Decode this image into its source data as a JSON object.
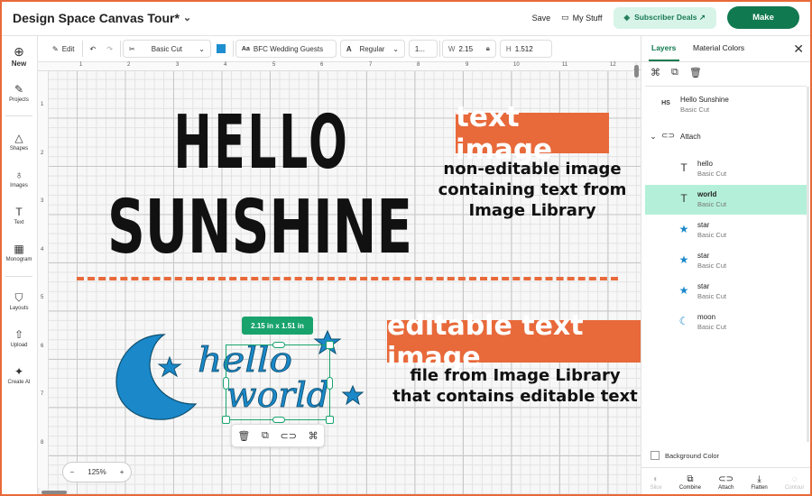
{
  "header": {
    "doc_title": "Design Space Canvas Tour*",
    "save": "Save",
    "my_stuff": "My Stuff",
    "subscriber_deals": "Subscriber Deals ↗",
    "make": "Make"
  },
  "left_rail": {
    "items": [
      {
        "label": "New",
        "icon": "plus-circle-icon"
      },
      {
        "label": "Projects",
        "icon": "projects-icon"
      },
      {
        "label": "Shapes",
        "icon": "shapes-icon"
      },
      {
        "label": "Images",
        "icon": "bulb-icon"
      },
      {
        "label": "Text",
        "icon": "text-icon"
      },
      {
        "label": "Monogram",
        "icon": "monogram-icon"
      },
      {
        "label": "Layouts",
        "icon": "shirt-icon"
      },
      {
        "label": "Upload",
        "icon": "upload-icon"
      },
      {
        "label": "Create AI",
        "icon": "sparkle-icon"
      }
    ]
  },
  "toolbar": {
    "edit": "Edit",
    "operation": "Basic Cut",
    "color": "#1e8ed1",
    "font": "BFC Wedding Guests",
    "style": "Regular",
    "size": "1...",
    "w_label": "W",
    "w_value": "2.15",
    "h_label": "H",
    "h_value": "1.512"
  },
  "rulers": {
    "top": [
      "1",
      "2",
      "3",
      "4",
      "5",
      "6",
      "7",
      "8",
      "9",
      "10",
      "11",
      "12"
    ],
    "left": [
      "1",
      "2",
      "3",
      "4",
      "5",
      "6",
      "7",
      "8"
    ]
  },
  "canvas": {
    "image_line1": "HELLO",
    "image_line2": "SUNSHINE",
    "editable_line1": "hello",
    "editable_line2": "world",
    "dimension_badge": "2.15 in x 1.51 in",
    "zoom": "125%",
    "zoom_minus": "−",
    "zoom_plus": "+"
  },
  "annotations": {
    "top_title": "text image",
    "top_desc_1": "non-editable image",
    "top_desc_2": "containing text from",
    "top_desc_3": "Image Library",
    "bottom_title": "editable text image",
    "bottom_desc_1": "file from Image Library",
    "bottom_desc_2": "that contains editable text",
    "accent": "#e8693a"
  },
  "panel": {
    "tab_layers": "Layers",
    "tab_material": "Material Colors",
    "layers": [
      {
        "name": "Hello Sunshine",
        "sub": "Basic Cut",
        "icon": "image-thumb-icon"
      },
      {
        "name": "Attach",
        "sub": "",
        "icon": "attach-icon"
      },
      {
        "name": "hello",
        "sub": "Basic Cut",
        "icon": "text-icon"
      },
      {
        "name": "world",
        "sub": "Basic Cut",
        "icon": "text-icon"
      },
      {
        "name": "star",
        "sub": "Basic Cut",
        "icon": "star-icon"
      },
      {
        "name": "star",
        "sub": "Basic Cut",
        "icon": "star-icon"
      },
      {
        "name": "star",
        "sub": "Basic Cut",
        "icon": "star-icon"
      },
      {
        "name": "moon",
        "sub": "Basic Cut",
        "icon": "moon-icon"
      }
    ],
    "background_color": "Background Color",
    "bottom_actions": [
      "Slice",
      "Combine",
      "Attach",
      "Flatten",
      "Contour"
    ]
  }
}
